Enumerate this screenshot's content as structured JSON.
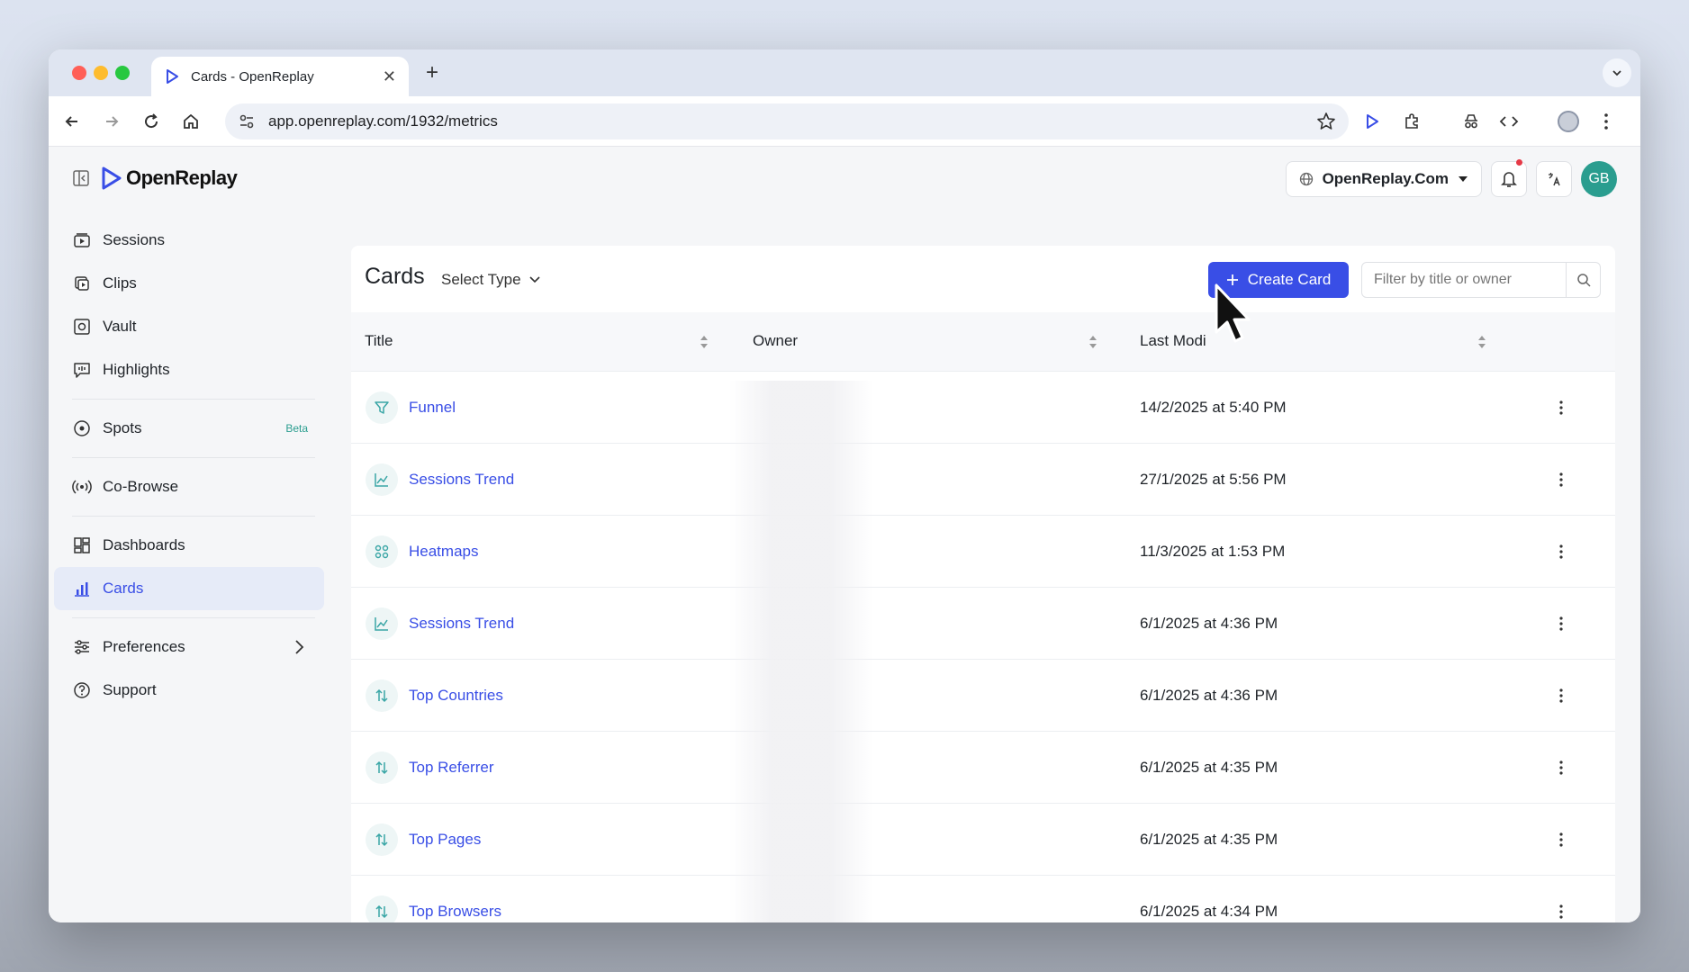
{
  "browser": {
    "tab_title": "Cards - OpenReplay",
    "new_tab_label": "+",
    "url": "app.openreplay.com/1932/metrics"
  },
  "app": {
    "logo_text": "OpenReplay",
    "project": "OpenReplay.Com",
    "avatar_initials": "GB"
  },
  "sidebar": {
    "items": [
      {
        "label": "Sessions",
        "icon": "play-box-icon"
      },
      {
        "label": "Clips",
        "icon": "clips-icon"
      },
      {
        "label": "Vault",
        "icon": "vault-icon"
      },
      {
        "label": "Highlights",
        "icon": "highlight-icon"
      },
      {
        "label": "Spots",
        "icon": "spot-icon",
        "badge": "Beta"
      },
      {
        "label": "Co-Browse",
        "icon": "broadcast-icon"
      },
      {
        "label": "Dashboards",
        "icon": "dashboard-icon"
      },
      {
        "label": "Cards",
        "icon": "bar-chart-icon",
        "active": true
      },
      {
        "label": "Preferences",
        "icon": "sliders-icon"
      },
      {
        "label": "Support",
        "icon": "help-icon"
      }
    ]
  },
  "main": {
    "title": "Cards",
    "select_type": "Select Type",
    "create_button": "Create Card",
    "filter_placeholder": "Filter by title or owner",
    "columns": [
      "Title",
      "Owner",
      "Last Modi"
    ],
    "rows": [
      {
        "title": "Funnel",
        "icon": "funnel-icon",
        "modified": "14/2/2025 at 5:40 PM"
      },
      {
        "title": "Sessions Trend",
        "icon": "line-chart-icon",
        "modified": "27/1/2025 at 5:56 PM"
      },
      {
        "title": "Heatmaps",
        "icon": "heatmap-icon",
        "modified": "11/3/2025 at 1:53 PM"
      },
      {
        "title": "Sessions Trend",
        "icon": "line-chart-icon",
        "modified": "6/1/2025 at 4:36 PM"
      },
      {
        "title": "Top Countries",
        "icon": "sort-arrows-icon",
        "modified": "6/1/2025 at 4:36 PM"
      },
      {
        "title": "Top Referrer",
        "icon": "sort-arrows-icon",
        "modified": "6/1/2025 at 4:35 PM"
      },
      {
        "title": "Top Pages",
        "icon": "sort-arrows-icon",
        "modified": "6/1/2025 at 4:35 PM"
      },
      {
        "title": "Top Browsers",
        "icon": "sort-arrows-icon",
        "modified": "6/1/2025 at 4:34 PM"
      }
    ]
  },
  "colors": {
    "accent": "#394ee6",
    "teal": "#2a9d8f",
    "active_bg": "#e6ebf8"
  }
}
